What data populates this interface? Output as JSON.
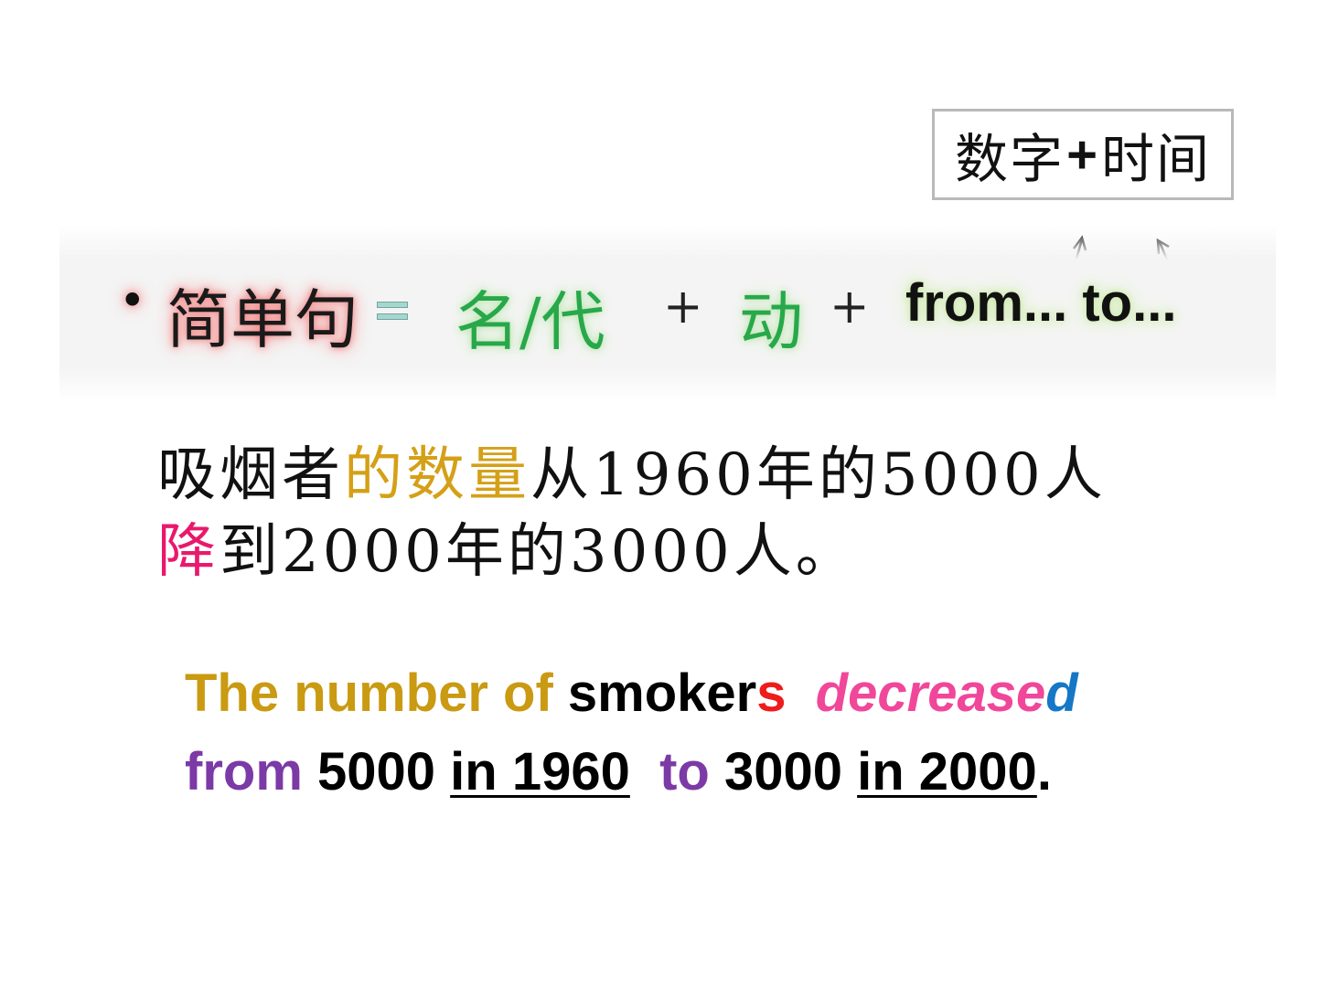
{
  "note": {
    "part1": "数字",
    "plus": "+",
    "part2": "时间"
  },
  "formula": {
    "bullet": "•",
    "simple_sentence": "简单句",
    "noun_pronoun": "名/代",
    "plus1": "+",
    "verb": "动",
    "plus2": "+",
    "from_to": "from... to..."
  },
  "chinese_sentence": {
    "seg1": "吸烟者",
    "seg2": "的数量",
    "seg3": "从1960年的5000人",
    "seg4": "降",
    "seg5": "到2000年的3000人。"
  },
  "english_sentence": {
    "the_number_of": "The number of ",
    "smoker": "smoker",
    "s": "s",
    "decrease": "decrease",
    "d": "d",
    "from": "from",
    "n5000": "5000",
    "in_1960": "in 1960",
    "to": "to",
    "n3000": "3000",
    "in_2000": "in 2000",
    "period": "."
  },
  "colors": {
    "gold": "#c99a12",
    "red": "#ee1c1c",
    "magenta": "#f0479a",
    "blue": "#1577c6",
    "purple": "#7b3aa6",
    "green": "#27a84a",
    "pink": "#e8196d"
  }
}
